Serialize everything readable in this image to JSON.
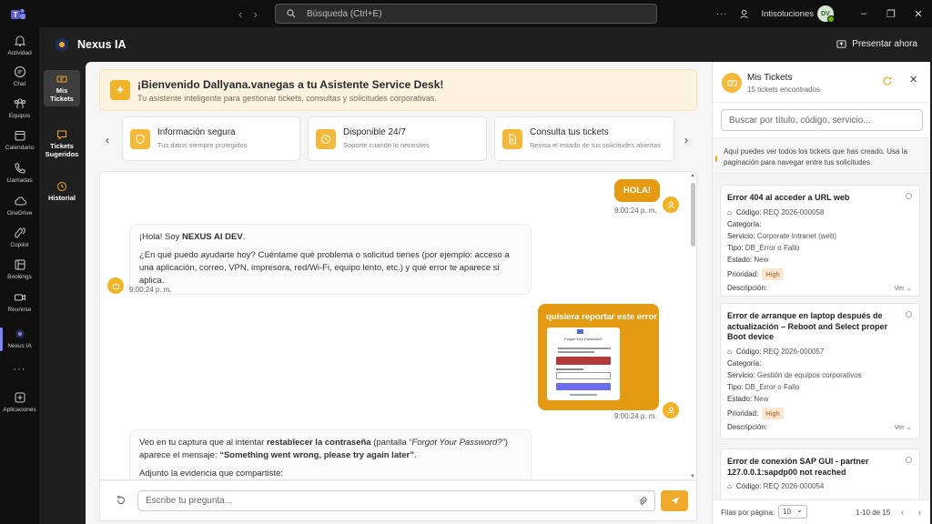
{
  "titlebar": {
    "search_placeholder": "Búsqueda (Ctrl+E)",
    "org": "Intisoluciones",
    "avatar": "DV",
    "more": "···"
  },
  "rail": [
    {
      "label": "Actividad",
      "icon": "bell-icon"
    },
    {
      "label": "Chat",
      "icon": "chat-icon"
    },
    {
      "label": "Equipos",
      "icon": "teams-icon"
    },
    {
      "label": "Calendario",
      "icon": "calendar-icon"
    },
    {
      "label": "Llamadas",
      "icon": "phone-icon"
    },
    {
      "label": "OneDrive",
      "icon": "cloud-icon"
    },
    {
      "label": "Copilot",
      "icon": "copilot-icon"
    },
    {
      "label": "Bookings",
      "icon": "bookings-icon"
    },
    {
      "label": "Reunirse",
      "icon": "video-icon"
    },
    {
      "label": "Nexus IA",
      "icon": "nexus-icon"
    },
    {
      "label": "Aplicaciones",
      "icon": "plus-square-icon"
    }
  ],
  "app": {
    "title": "Nexus IA",
    "present": "Presentar ahora"
  },
  "left_nav": [
    {
      "label": "Mis Tickets"
    },
    {
      "label": "Tickets Sugeridos"
    },
    {
      "label": "Historial"
    }
  ],
  "welcome": {
    "title": "¡Bienvenido Dallyana.vanegas a tu Asistente Service Desk!",
    "subtitle": "Tu asistente inteligente para gestionar tickets, consultas y solicitudes corporativas."
  },
  "features": [
    {
      "title": "Información segura",
      "sub": "Tus datos siempre protegidos"
    },
    {
      "title": "Disponible 24/7",
      "sub": "Soporte cuando lo necesites"
    },
    {
      "title": "Consulta tus tickets",
      "sub": "Revisa el estado de tus solicitudes abiertas"
    }
  ],
  "chat": {
    "msg1": "HOLA!",
    "time1": "9:00:24 p. m.",
    "bot1_p1_a": "¡Hola! Soy ",
    "bot1_p1_b": "NEXUS AI DEV",
    "bot1_p1_c": ".",
    "bot1_p2": "¿En qué puedo ayudarte hoy? Cuéntame qué problema o solicitud tienes (por ejemplo: acceso a una aplicación, correo, VPN, impresora, red/Wi-Fi, equipo lento, etc.) y qué error te aparece si aplica.",
    "time2": "9:00:24 p. m.",
    "msg2": "quisiera reportar este error",
    "shot_title": "Forgot Your Password?",
    "time3": "9:00:24 p. m.",
    "bot2_a": "Veo en tu captura que al intentar ",
    "bot2_b": "restablecer la contraseña",
    "bot2_c": " (pantalla ",
    "bot2_d": "“Forgot Your Password?”",
    "bot2_e": ") aparece el mensaje: ",
    "bot2_f": "“Something went wrong, please try again later”",
    "bot2_g": ".",
    "bot2_p2": "Adjunto la evidencia que compartiste:"
  },
  "composer": {
    "placeholder": "Escribe tu pregunta..."
  },
  "panel": {
    "title": "Mis Tickets",
    "count": "15 tickets encontrados",
    "search_placeholder": "Buscar por título, código, servicio...",
    "info": "Aquí puedes ver todos los tickets que has creado. Usa la paginación para navegar entre tus solicitudes.",
    "labels": {
      "codigo": "Código:",
      "categoria": "Categoría:",
      "servicio": "Servicio:",
      "tipo": "Tipo:",
      "estado": "Estado:",
      "prioridad": "Prioridad:",
      "descripcion": "Descripción:",
      "ver": "Ver"
    },
    "tickets": [
      {
        "title": "Error 404 al acceder a URL web",
        "code": "REQ 2026-000058",
        "service": "Corporate Intranet (web)",
        "type": "DB_Error o Fallo",
        "state": "New",
        "priority": "High"
      },
      {
        "title": "Error de arranque en laptop después de actualización – Reboot and Select proper Boot device",
        "code": "REQ 2026-000057",
        "service": "Gestión de equipos corporativos",
        "type": "DB_Error o Fallo",
        "state": "New",
        "priority": "High"
      },
      {
        "title": "Error de conexión SAP GUI - partner 127.0.0.1:sapdp00 not reached",
        "code": "REQ 2026-000054"
      }
    ],
    "footer": {
      "per_page_label": "Filas por página:",
      "per_page": "10",
      "range": "1-10 de 15"
    }
  },
  "colors": {
    "accent": "#f0a92b",
    "bubble": "#e49a13",
    "rail_active": "#7f85f5"
  }
}
